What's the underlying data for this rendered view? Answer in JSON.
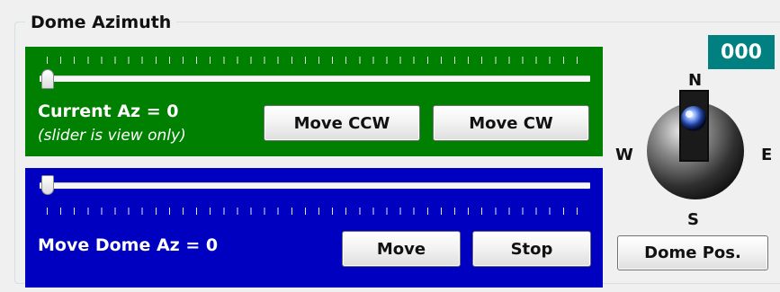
{
  "group": {
    "title": "Dome Azimuth"
  },
  "current": {
    "label": "Current Az = 0",
    "note": "(slider is view only)",
    "slider_value": 0,
    "ccw_button": "Move CCW",
    "cw_button": "Move CW"
  },
  "target": {
    "label": "Move Dome Az = 0",
    "slider_value": 0,
    "move_button": "Move",
    "stop_button": "Stop"
  },
  "compass": {
    "readout": "000",
    "north": "N",
    "south": "S",
    "east": "E",
    "west": "W",
    "pos_button": "Dome Pos."
  },
  "colors": {
    "current_panel": "#008000",
    "target_panel": "#0000c0",
    "readout_bg": "#008080"
  }
}
